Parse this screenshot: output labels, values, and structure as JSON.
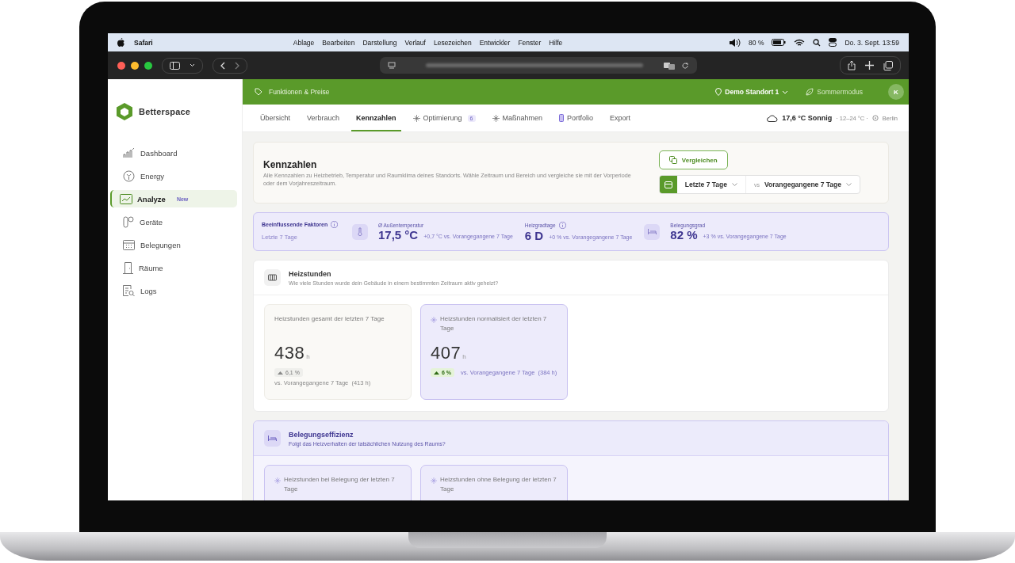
{
  "menubar": {
    "app": "Safari",
    "items": [
      "Ablage",
      "Bearbeiten",
      "Darstellung",
      "Verlauf",
      "Lesezeichen",
      "Entwickler",
      "Fenster",
      "Hilfe"
    ],
    "battery": "80 %",
    "datetime": "Do. 3. Sept. 13:59"
  },
  "sidebar": {
    "brand": "Betterspace",
    "items": [
      {
        "label": "Dashboard",
        "kind": "chart",
        "selected": false
      },
      {
        "label": "Energy",
        "kind": "energy",
        "selected": false
      },
      {
        "label": "Analyze",
        "kind": "analyze",
        "selected": true,
        "badge": "New"
      },
      {
        "label": "Geräte",
        "kind": "device",
        "selected": false
      },
      {
        "label": "Belegungen",
        "kind": "calendar",
        "selected": false
      },
      {
        "label": "Räume",
        "kind": "door",
        "selected": false
      },
      {
        "label": "Logs",
        "kind": "logs",
        "selected": false
      }
    ]
  },
  "topbar": {
    "promo": "Funktionen & Preise",
    "location": "Demo Standort 1",
    "mode": "Sommermodus",
    "avatar": "K"
  },
  "tabs": [
    {
      "label": "Übersicht",
      "kind": "plain",
      "selected": false
    },
    {
      "label": "Verbrauch",
      "kind": "plain",
      "selected": false
    },
    {
      "label": "Kennzahlen",
      "kind": "plain",
      "selected": true
    },
    {
      "label": "Optimierung",
      "kind": "sparkle",
      "selected": false,
      "badge": "6"
    },
    {
      "label": "Maßnahmen",
      "kind": "sparkle",
      "selected": false
    },
    {
      "label": "Portfolio",
      "kind": "portfolio",
      "selected": false
    },
    {
      "label": "Export",
      "kind": "plain",
      "selected": false
    }
  ],
  "weather": {
    "summary": "17,6 °C Sonnig",
    "range": "· 12–24 °C ·",
    "city": "Berlin"
  },
  "header": {
    "title": "Kennzahlen",
    "description": "Alle Kennzahlen zu Heizbetrieb, Temperatur und Raumklima deines Standorts. Wähle Zeitraum und Bereich und vergleiche sie mit der Vorperiode oder dem Vorjahreszeitraum.",
    "compare_button": "Vergleichen",
    "period": "Letzte 7 Tage",
    "vs": "vs",
    "compare_period": "Vorangegangene 7 Tage"
  },
  "factors": {
    "title": "Beeinflussende Faktoren",
    "subtitle": "Letzte 7 Tage",
    "items": [
      {
        "kind": "thermometer",
        "label": "Ø Außentemperatur",
        "value": "17,5 °C",
        "delta": "+0,7 °C vs. Vorangegangene 7 Tage",
        "info": false
      },
      {
        "kind": "none",
        "label": "Heizgradtage",
        "value": "6 D",
        "delta": "+0 % vs. Vorangegangene 7 Tage",
        "info": true
      },
      {
        "kind": "bed",
        "label": "Belegungsgrad",
        "value": "82 %",
        "delta": "+3 % vs. Vorangegangene 7 Tage",
        "info": false
      }
    ]
  },
  "sections": [
    {
      "kind": "radiator",
      "tinted": false,
      "title": "Heizstunden",
      "subtitle": "Wie viele Stunden wurde dein Gebäude in einem bestimmten Zeitraum aktiv geheizt?",
      "cards": [
        {
          "title": "Heizstunden gesamt der letzten 7 Tage",
          "sparkle": false,
          "highlighted": false,
          "value": "438",
          "unit": "h",
          "change": "6,1 %",
          "note": "vs. Vorangegangene 7 Tage  (413 h)"
        },
        {
          "title": "Heizstunden normalisiert der letzten 7 Tage",
          "sparkle": true,
          "highlighted": true,
          "value": "407",
          "unit": "h",
          "change": "6 %",
          "note": "vs. Vorangegangene 7 Tage  (384 h)"
        }
      ]
    },
    {
      "kind": "bed",
      "tinted": true,
      "title": "Belegungseffizienz",
      "subtitle": "Folgt das Heizverhalten der tatsächlichen Nutzung des Raums?",
      "cards": [
        {
          "title": "Heizstunden bei Belegung der letzten 7 Tage",
          "sparkle": true,
          "highlighted": true
        },
        {
          "title": "Heizstunden ohne Belegung der letzten 7 Tage",
          "sparkle": true,
          "highlighted": true
        }
      ]
    }
  ]
}
